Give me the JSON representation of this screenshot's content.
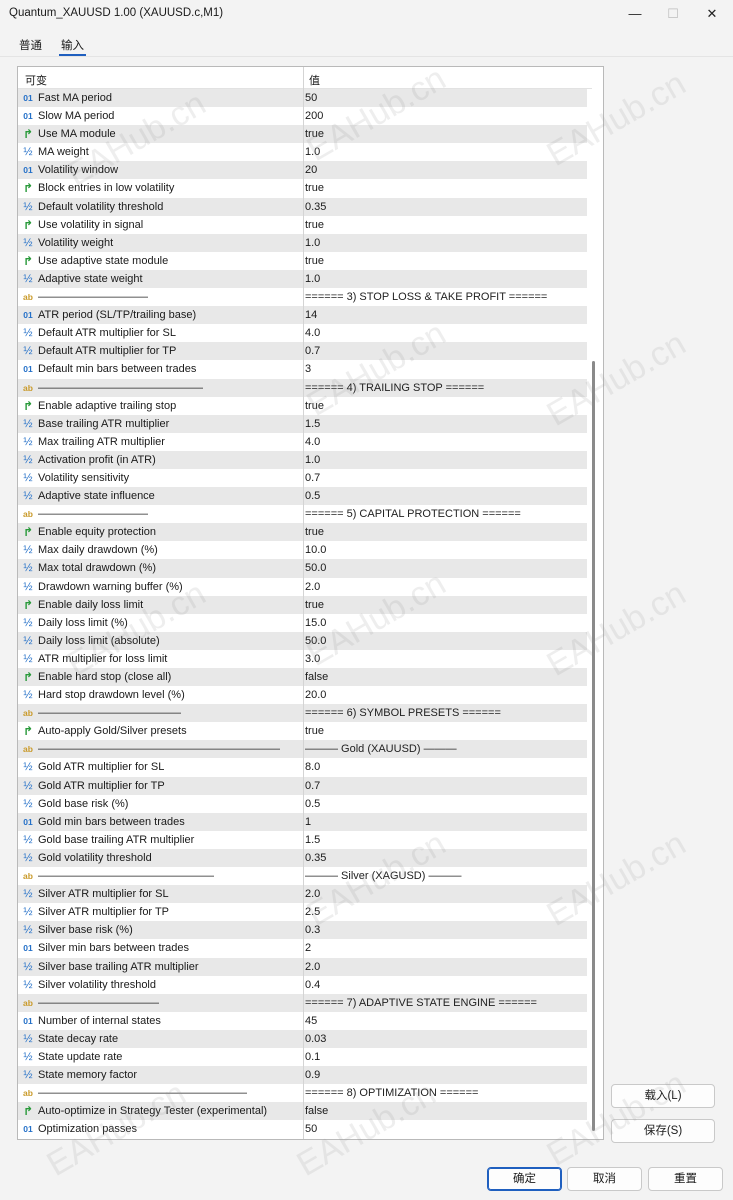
{
  "window": {
    "title": "Quantum_XAUUSD 1.00 (XAUUSD.c,M1)",
    "minimize_glyph": "—",
    "maximize_glyph": "☐",
    "close_glyph": "✕"
  },
  "tabs": [
    {
      "label": "普通",
      "active": false
    },
    {
      "label": "输入",
      "active": true
    }
  ],
  "grid": {
    "header": {
      "variable": "可变",
      "value": "值"
    },
    "icon_glyphs": {
      "int": "01",
      "double": "½",
      "bool": "↱",
      "string": "ab"
    },
    "rows": [
      {
        "type": "int",
        "name": "Fast MA period",
        "value": "50"
      },
      {
        "type": "int",
        "name": "Slow MA period",
        "value": "200"
      },
      {
        "type": "bool",
        "name": "Use MA module",
        "value": "true"
      },
      {
        "type": "double",
        "name": "MA weight",
        "value": "1.0"
      },
      {
        "type": "int",
        "name": "Volatility window",
        "value": "20"
      },
      {
        "type": "bool",
        "name": "Block entries in low volatility",
        "value": "true"
      },
      {
        "type": "double",
        "name": "Default volatility threshold",
        "value": "0.35"
      },
      {
        "type": "bool",
        "name": "Use volatility in signal",
        "value": "true"
      },
      {
        "type": "double",
        "name": "Volatility weight",
        "value": "1.0"
      },
      {
        "type": "bool",
        "name": "Use adaptive state module",
        "value": "true"
      },
      {
        "type": "double",
        "name": "Adaptive state weight",
        "value": "1.0"
      },
      {
        "type": "string",
        "name": "——————————",
        "value": "====== 3) STOP LOSS & TAKE PROFIT ======"
      },
      {
        "type": "int",
        "name": "ATR period (SL/TP/trailing base)",
        "value": "14"
      },
      {
        "type": "double",
        "name": "Default ATR multiplier for SL",
        "value": "4.0"
      },
      {
        "type": "double",
        "name": "Default ATR multiplier for TP",
        "value": "0.7"
      },
      {
        "type": "int",
        "name": "Default min bars between trades",
        "value": "3"
      },
      {
        "type": "string",
        "name": "———————————————",
        "value": "====== 4) TRAILING STOP ======"
      },
      {
        "type": "bool",
        "name": "Enable adaptive trailing stop",
        "value": "true"
      },
      {
        "type": "double",
        "name": "Base trailing ATR multiplier",
        "value": "1.5"
      },
      {
        "type": "double",
        "name": "Max trailing ATR multiplier",
        "value": "4.0"
      },
      {
        "type": "double",
        "name": "Activation profit (in ATR)",
        "value": "1.0"
      },
      {
        "type": "double",
        "name": "Volatility sensitivity",
        "value": "0.7"
      },
      {
        "type": "double",
        "name": "Adaptive state influence",
        "value": "0.5"
      },
      {
        "type": "string",
        "name": "——————————",
        "value": "====== 5) CAPITAL PROTECTION ======"
      },
      {
        "type": "bool",
        "name": "Enable equity protection",
        "value": "true"
      },
      {
        "type": "double",
        "name": "Max daily drawdown (%)",
        "value": "10.0"
      },
      {
        "type": "double",
        "name": "Max total drawdown (%)",
        "value": "50.0"
      },
      {
        "type": "double",
        "name": "Drawdown warning buffer (%)",
        "value": "2.0"
      },
      {
        "type": "bool",
        "name": "Enable daily loss limit",
        "value": "true"
      },
      {
        "type": "double",
        "name": "Daily loss limit (%)",
        "value": "15.0"
      },
      {
        "type": "double",
        "name": "Daily loss limit (absolute)",
        "value": "50.0"
      },
      {
        "type": "double",
        "name": "ATR multiplier for loss limit",
        "value": "3.0"
      },
      {
        "type": "bool",
        "name": "Enable hard stop (close all)",
        "value": "false"
      },
      {
        "type": "double",
        "name": "Hard stop drawdown level (%)",
        "value": "20.0"
      },
      {
        "type": "string",
        "name": "—————————————",
        "value": "====== 6) SYMBOL PRESETS ======"
      },
      {
        "type": "bool",
        "name": "Auto-apply Gold/Silver presets",
        "value": "true"
      },
      {
        "type": "string",
        "name": "——————————————————————",
        "value": "——— Gold (XAUUSD) ———"
      },
      {
        "type": "double",
        "name": "Gold ATR multiplier for SL",
        "value": "8.0"
      },
      {
        "type": "double",
        "name": "Gold ATR multiplier for TP",
        "value": "0.7"
      },
      {
        "type": "double",
        "name": "Gold base risk (%)",
        "value": "0.5"
      },
      {
        "type": "int",
        "name": "Gold min bars between trades",
        "value": "1"
      },
      {
        "type": "double",
        "name": "Gold base trailing ATR multiplier",
        "value": "1.5"
      },
      {
        "type": "double",
        "name": "Gold volatility threshold",
        "value": "0.35"
      },
      {
        "type": "string",
        "name": "————————————————",
        "value": "——— Silver (XAGUSD) ———"
      },
      {
        "type": "double",
        "name": "Silver ATR multiplier for SL",
        "value": "2.0"
      },
      {
        "type": "double",
        "name": "Silver ATR multiplier for TP",
        "value": "2.5"
      },
      {
        "type": "double",
        "name": "Silver base risk (%)",
        "value": "0.3"
      },
      {
        "type": "int",
        "name": "Silver min bars between trades",
        "value": "2"
      },
      {
        "type": "double",
        "name": "Silver base trailing ATR multiplier",
        "value": "2.0"
      },
      {
        "type": "double",
        "name": "Silver volatility threshold",
        "value": "0.4"
      },
      {
        "type": "string",
        "name": "———————————",
        "value": "====== 7) ADAPTIVE STATE ENGINE ======"
      },
      {
        "type": "int",
        "name": "Number of internal states",
        "value": "45"
      },
      {
        "type": "double",
        "name": "State decay rate",
        "value": "0.03"
      },
      {
        "type": "double",
        "name": "State update rate",
        "value": "0.1"
      },
      {
        "type": "double",
        "name": "State memory factor",
        "value": "0.9"
      },
      {
        "type": "string",
        "name": "———————————————————",
        "value": "====== 8) OPTIMIZATION ======"
      },
      {
        "type": "bool",
        "name": "Auto-optimize in Strategy Tester (experimental)",
        "value": "false"
      },
      {
        "type": "int",
        "name": "Optimization passes",
        "value": "50"
      }
    ]
  },
  "side_buttons": {
    "load": "载入(L)",
    "save": "保存(S)"
  },
  "footer_buttons": {
    "ok": "确定",
    "cancel": "取消",
    "reset": "重置"
  },
  "watermark": "EAHub.cn"
}
